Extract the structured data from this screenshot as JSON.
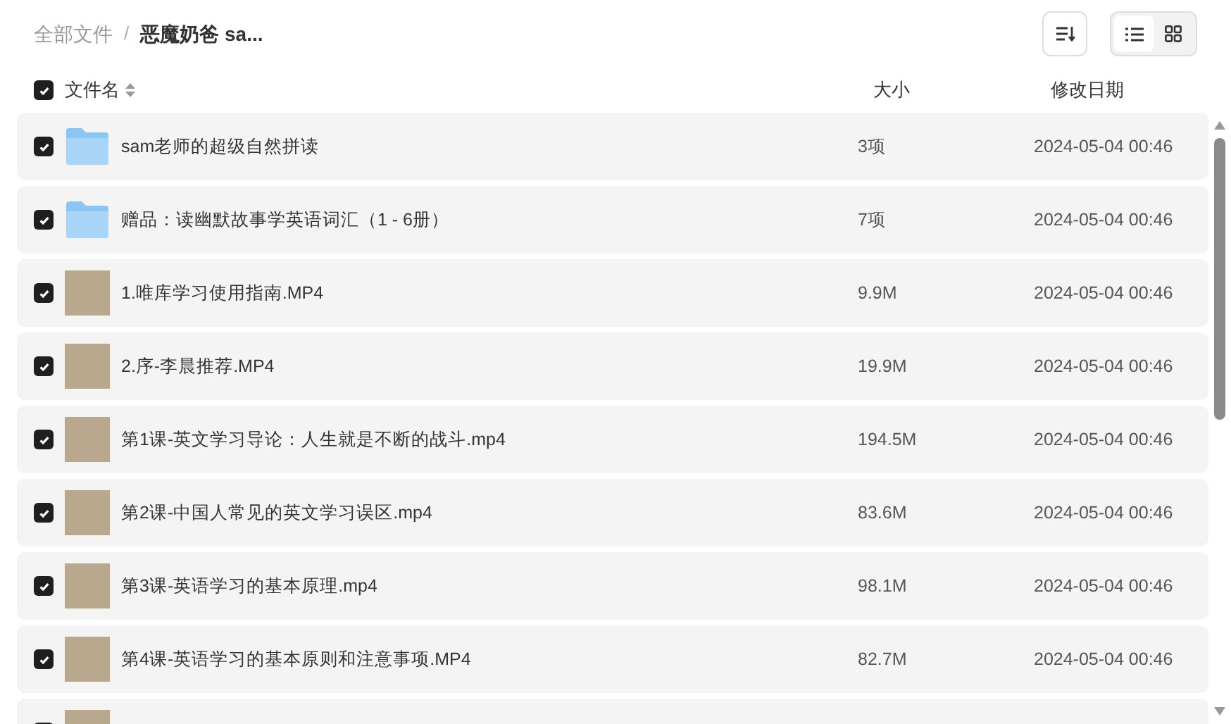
{
  "breadcrumb_separator": "/",
  "breadcrumb": [
    {
      "label": "全部文件",
      "current": false
    },
    {
      "label": "恶魔奶爸 sa...",
      "current": true
    }
  ],
  "view_toggle": [
    {
      "kind": "list",
      "selected": true
    },
    {
      "kind": "grid",
      "selected": false
    }
  ],
  "header": {
    "checked": true,
    "name": "文件名",
    "size": "大小",
    "date": "修改日期"
  },
  "rows": [
    {
      "kind": "folder",
      "checked": true,
      "name": "sam老师的超级自然拼读",
      "size": "3项",
      "date": "2024-05-04 00:46"
    },
    {
      "kind": "folder",
      "checked": true,
      "name": "赠品：读幽默故事学英语词汇（1 - 6册）",
      "size": "7项",
      "date": "2024-05-04 00:46"
    },
    {
      "kind": "video",
      "checked": true,
      "name": "1.唯库学习使用指南.MP4",
      "size": "9.9M",
      "date": "2024-05-04 00:46"
    },
    {
      "kind": "video",
      "checked": true,
      "name": "2.序-李晨推荐.MP4",
      "size": "19.9M",
      "date": "2024-05-04 00:46"
    },
    {
      "kind": "video",
      "checked": true,
      "name": "第1课-英文学习导论：人生就是不断的战斗.mp4",
      "size": "194.5M",
      "date": "2024-05-04 00:46"
    },
    {
      "kind": "video",
      "checked": true,
      "name": "第2课-中国人常见的英文学习误区.mp4",
      "size": "83.6M",
      "date": "2024-05-04 00:46"
    },
    {
      "kind": "video",
      "checked": true,
      "name": "第3课-英语学习的基本原理.mp4",
      "size": "98.1M",
      "date": "2024-05-04 00:46"
    },
    {
      "kind": "video",
      "checked": true,
      "name": "第4课-英语学习的基本原则和注意事项.MP4",
      "size": "82.7M",
      "date": "2024-05-04 00:46"
    },
    {
      "kind": "video",
      "checked": true
    }
  ]
}
